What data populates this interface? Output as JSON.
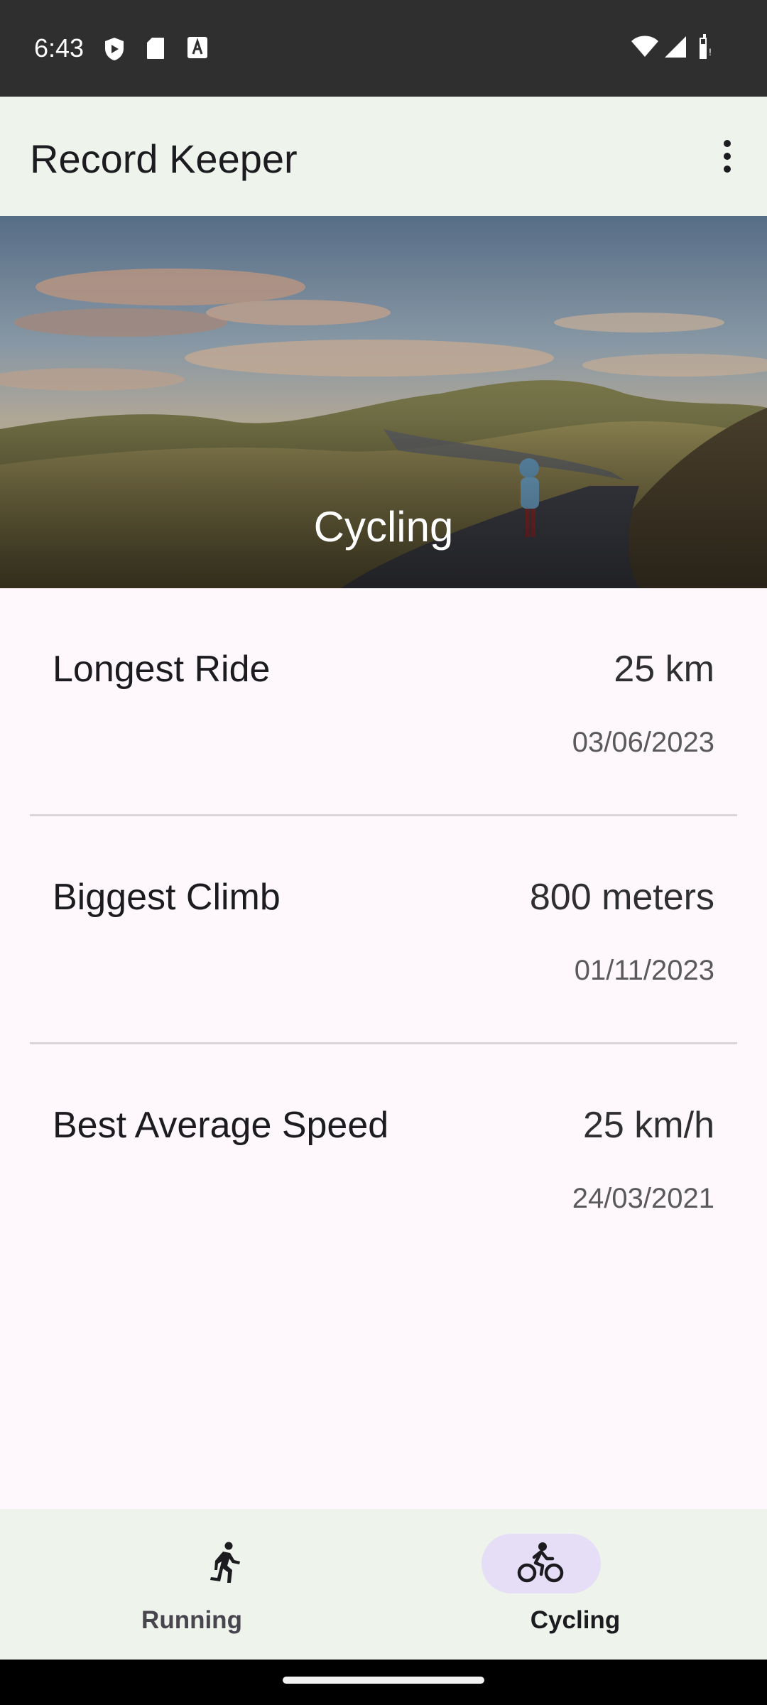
{
  "status_bar": {
    "time": "6:43",
    "icons": [
      "shield-icon",
      "sd-card-icon",
      "font-a-icon",
      "wifi-icon",
      "signal-icon",
      "battery-icon"
    ]
  },
  "app_bar": {
    "title": "Record Keeper",
    "menu_icon": "more-vert-icon"
  },
  "hero": {
    "title": "Cycling",
    "image": "cyclist-on-mountain-road"
  },
  "records": [
    {
      "label": "Longest Ride",
      "value": "25 km",
      "date": "03/06/2023"
    },
    {
      "label": "Biggest Climb",
      "value": "800 meters",
      "date": "01/11/2023"
    },
    {
      "label": "Best Average Speed",
      "value": "25 km/h",
      "date": "24/03/2021"
    }
  ],
  "bottom_nav": {
    "items": [
      {
        "label": "Running",
        "icon": "running-icon",
        "selected": false
      },
      {
        "label": "Cycling",
        "icon": "cycling-icon",
        "selected": true
      }
    ]
  },
  "colors": {
    "app_bar_bg": "#eef3ec",
    "page_bg": "#fef8fc",
    "status_bar_bg": "#2f2f2f",
    "active_pill": "#e5def6"
  }
}
